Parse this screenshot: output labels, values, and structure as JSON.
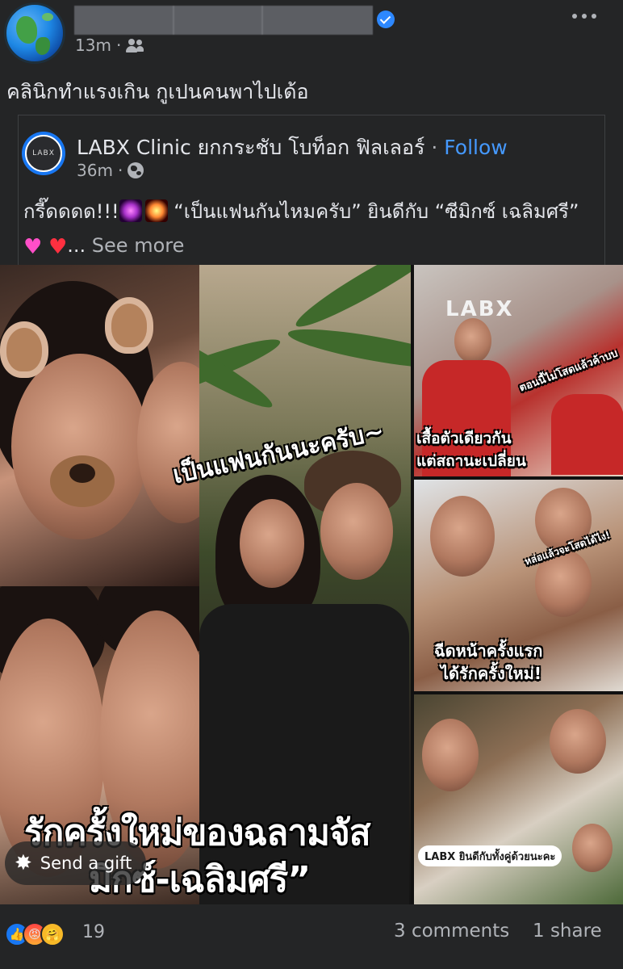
{
  "post": {
    "author_name_hidden": "",
    "time": "13m",
    "separator": "·",
    "audience_icon": "friends-icon",
    "menu_icon": "more-options-icon",
    "caption": "คลินิกทำแรงเกิน กูเปนคนพาไปเด้อ"
  },
  "shared": {
    "page_name": "LABX Clinic ยกกระชับ โบท็อก ฟิลเลอร์",
    "separator": "·",
    "follow_label": "Follow",
    "time": "36m",
    "audience_icon": "globe-icon",
    "avatar_text": "LABX",
    "text_part1": "กรี๊ดดดด!!!",
    "text_part2": " “เป็นแฟนกันไหมครับ” ยินดีกับ “ซีมิกซ์ เฉลิมศรี” ",
    "ellipsis": "...",
    "see_more": "See more"
  },
  "collage": {
    "overlay_mid": "เป็นแฟนกันนะครับ~",
    "overlay_big_line1": "รักครั้งใหม่ของฉลามจัส",
    "overlay_big_line2": "มิกซ์-เฉลิมศรี”",
    "sign_text": "LABX",
    "overlay_r1_line1": "เสื้อตัวเดียวกัน",
    "overlay_r1_line2": "แต่สถานะเปลี่ยน",
    "overlay_r1_small": "ตอนนี้ไม่โสดแล้วค้าบบ",
    "overlay_r2_line1": "ฉีดหน้าครั้งแรก",
    "overlay_r2_line2": "ได้รักครั้งใหม่!",
    "overlay_r2_small": "หล่อแล้วจะโสดได้ไง!",
    "badge_r3": "LABX ยินดีกับทั้งคู่ด้วยนะคะ"
  },
  "gift": {
    "label": "Send a gift",
    "icon": "star-icon"
  },
  "footer": {
    "reaction_icons": [
      "like-icon",
      "angry-icon",
      "care-icon"
    ],
    "reaction_count": "19",
    "comments": "3 comments",
    "shares": "1 share"
  },
  "colors": {
    "background": "#242526",
    "text_primary": "#e4e6eb",
    "text_secondary": "#b0b3b8",
    "link_blue": "#4599ff",
    "verified_blue": "#2d88ff"
  }
}
